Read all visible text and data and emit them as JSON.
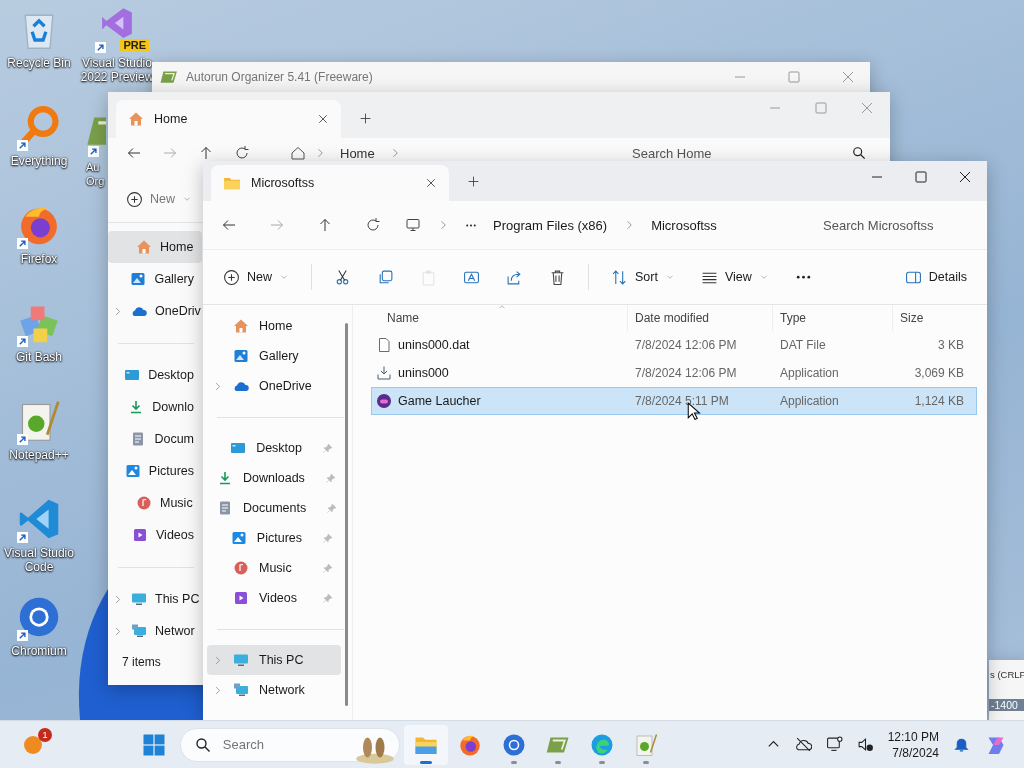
{
  "desktop_icons": [
    {
      "label": "Recycle Bin",
      "kind": "recycle",
      "shortcut": false
    },
    {
      "label": "Everything",
      "kind": "everything",
      "shortcut": true
    },
    {
      "label": "Firefox",
      "kind": "firefox",
      "shortcut": true
    },
    {
      "label": "Git Bash",
      "kind": "gitbash",
      "shortcut": true
    },
    {
      "label": "Notepad++",
      "kind": "notepad",
      "shortcut": true
    },
    {
      "label": "Visual Studio Code",
      "kind": "vscode",
      "shortcut": true
    },
    {
      "label": "Chromium",
      "kind": "chromium",
      "shortcut": true
    }
  ],
  "desktop_icons_column_2": [
    {
      "label": "Visual Studio 2022 Preview",
      "kind": "vs",
      "shortcut": true,
      "badge": "PRE"
    },
    {
      "label": "Au Org",
      "kind": "autorun",
      "shortcut": true
    }
  ],
  "background_window": {
    "title": "Autorun Organizer 5.41 (Freeware)"
  },
  "partial_window": {
    "lines": [
      "s (CRLF",
      "-1400"
    ]
  },
  "home_window": {
    "tab": "Home",
    "breadcrumb": [
      "Home"
    ],
    "search": {
      "placeholder": "Search Home"
    },
    "new_label": "New",
    "status_bar": "7 items",
    "sidebar": [
      [
        {
          "label": "Home",
          "kind": "home",
          "selected": true,
          "expandable": false
        },
        {
          "label": "Gallery",
          "kind": "gallery",
          "selected": false,
          "expandable": false
        },
        {
          "label": "OneDriv",
          "kind": "onedrive",
          "selected": false,
          "expandable": true
        }
      ],
      [
        {
          "label": "Desktop",
          "kind": "desktop",
          "selected": false,
          "expandable": false
        },
        {
          "label": "Downlo",
          "kind": "downloads",
          "selected": false,
          "expandable": false
        },
        {
          "label": "Docum",
          "kind": "documents",
          "selected": false,
          "expandable": false
        },
        {
          "label": "Pictures",
          "kind": "pictures",
          "selected": false,
          "expandable": false
        },
        {
          "label": "Music",
          "kind": "music",
          "selected": false,
          "expandable": false
        },
        {
          "label": "Videos",
          "kind": "videos",
          "selected": false,
          "expandable": false
        }
      ],
      [
        {
          "label": "This PC",
          "kind": "thispc",
          "selected": false,
          "expandable": true
        },
        {
          "label": "Networ",
          "kind": "network",
          "selected": false,
          "expandable": true
        }
      ]
    ]
  },
  "main_window": {
    "tab": "Microsoftss",
    "breadcrumb": [
      "Program Files (x86)",
      "Microsoftss"
    ],
    "search": {
      "placeholder": "Search Microsoftss"
    },
    "toolbar": [
      {
        "kind": "new",
        "label": "New",
        "disabled": false
      },
      {
        "kind": "cut",
        "disabled": false
      },
      {
        "kind": "copy",
        "disabled": false
      },
      {
        "kind": "paste",
        "disabled": true
      },
      {
        "kind": "rename",
        "disabled": false
      },
      {
        "kind": "share",
        "disabled": false
      },
      {
        "kind": "delete",
        "disabled": false
      },
      {
        "kind": "sort",
        "label": "Sort",
        "disabled": false
      },
      {
        "kind": "view",
        "label": "View",
        "disabled": false
      },
      {
        "kind": "more",
        "disabled": false
      }
    ],
    "details_label": "Details",
    "sidebar": [
      [
        {
          "label": "Home",
          "kind": "home",
          "selected": false,
          "expandable": false,
          "pinned": false
        },
        {
          "label": "Gallery",
          "kind": "gallery",
          "selected": false,
          "expandable": false,
          "pinned": false
        },
        {
          "label": "OneDrive",
          "kind": "onedrive",
          "selected": false,
          "expandable": true,
          "pinned": false
        }
      ],
      [
        {
          "label": "Desktop",
          "kind": "desktop",
          "selected": false,
          "expandable": false,
          "pinned": true
        },
        {
          "label": "Downloads",
          "kind": "downloads",
          "selected": false,
          "expandable": false,
          "pinned": true
        },
        {
          "label": "Documents",
          "kind": "documents",
          "selected": false,
          "expandable": false,
          "pinned": true
        },
        {
          "label": "Pictures",
          "kind": "pictures",
          "selected": false,
          "expandable": false,
          "pinned": true
        },
        {
          "label": "Music",
          "kind": "music",
          "selected": false,
          "expandable": false,
          "pinned": true
        },
        {
          "label": "Videos",
          "kind": "videos",
          "selected": false,
          "expandable": false,
          "pinned": true
        }
      ],
      [
        {
          "label": "This PC",
          "kind": "thispc",
          "selected": true,
          "expandable": true,
          "pinned": false
        },
        {
          "label": "Network",
          "kind": "network",
          "selected": false,
          "expandable": true,
          "pinned": false
        }
      ]
    ],
    "columns": [
      "Name",
      "Date modified",
      "Type",
      "Size"
    ],
    "rows": [
      {
        "name": "unins000.dat",
        "kind": "file",
        "date": "7/8/2024 12:06 PM",
        "type": "DAT File",
        "size": "3 KB",
        "selected": false
      },
      {
        "name": "unins000",
        "kind": "installer",
        "date": "7/8/2024 12:06 PM",
        "type": "Application",
        "size": "3,069 KB",
        "selected": false
      },
      {
        "name": "Game Laucher",
        "kind": "gameapp",
        "date": "7/8/2024 5:11 PM",
        "type": "Application",
        "size": "1,124 KB",
        "selected": true
      }
    ]
  },
  "taskbar": {
    "notification_badge": "1",
    "search": {
      "placeholder": "Search"
    },
    "apps": [
      {
        "kind": "explorer",
        "running": true,
        "active": true
      },
      {
        "kind": "firefox",
        "running": false,
        "active": false
      },
      {
        "kind": "chromium",
        "running": true,
        "active": false
      },
      {
        "kind": "autorun",
        "running": true,
        "active": false
      },
      {
        "kind": "edge",
        "running": true,
        "active": false
      },
      {
        "kind": "notepad",
        "running": true,
        "active": false
      }
    ],
    "time": "12:10 PM",
    "date": "7/8/2024"
  }
}
